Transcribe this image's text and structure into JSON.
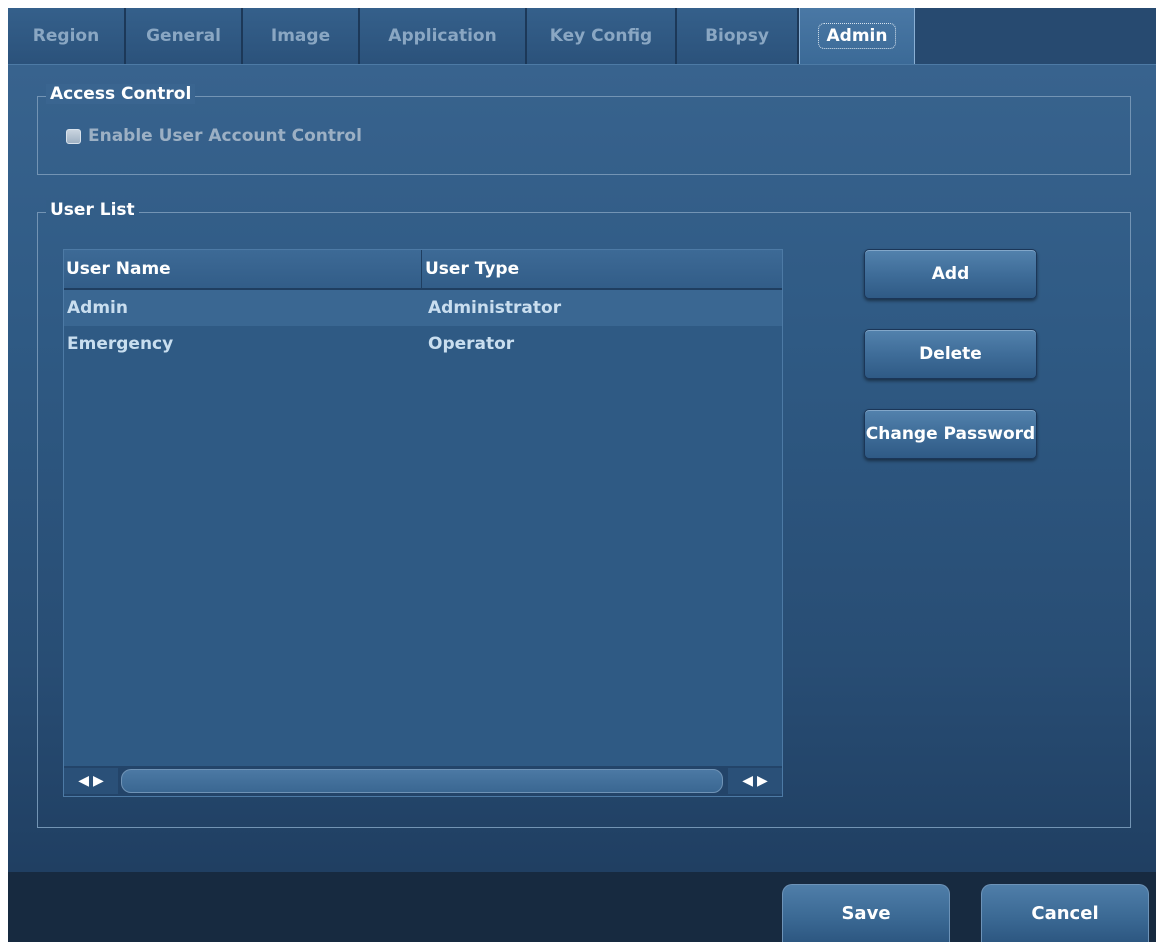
{
  "tabs": [
    {
      "label": "Region"
    },
    {
      "label": "General"
    },
    {
      "label": "Image"
    },
    {
      "label": "Application"
    },
    {
      "label": "Key Config"
    },
    {
      "label": "Biopsy"
    },
    {
      "label": "Admin",
      "active": true
    }
  ],
  "access_control": {
    "title": "Access Control",
    "checkbox_label": "Enable User Account Control",
    "checked": false
  },
  "user_list": {
    "title": "User List",
    "columns": [
      "User Name",
      "User Type"
    ],
    "rows": [
      {
        "name": "Admin",
        "type": "Administrator",
        "selected": true
      },
      {
        "name": "Emergency",
        "type": "Operator",
        "selected": false
      }
    ]
  },
  "buttons": {
    "add": "Add",
    "delete": "Delete",
    "change_password": "Change Password"
  },
  "footer": {
    "save": "Save",
    "cancel": "Cancel"
  },
  "icons": {
    "scroll_left": "left-arrow-icon",
    "scroll_right": "right-arrow-icon"
  }
}
